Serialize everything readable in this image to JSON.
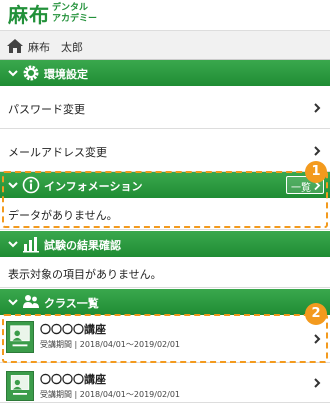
{
  "header": {
    "logo_main": "麻布",
    "logo_sub_1": "デンタル",
    "logo_sub_2": "アカデミー"
  },
  "user": {
    "name": "麻布　太郎"
  },
  "settings": {
    "title": "環境設定",
    "items": [
      {
        "label": "パスワード変更"
      },
      {
        "label": "メールアドレス変更"
      }
    ]
  },
  "information": {
    "title": "インフォメーション",
    "list_button": "一覧",
    "empty_text": "データがありません。",
    "badge": "1"
  },
  "exam": {
    "title": "試験の結果確認",
    "empty_text": "表示対象の項目がありません。"
  },
  "classes": {
    "title": "クラス一覧",
    "badge": "2",
    "items": [
      {
        "title": "〇〇〇〇講座",
        "period": "受講期間 | 2018/04/01〜2019/02/01"
      },
      {
        "title": "〇〇〇〇講座",
        "period": "受講期間 | 2018/04/01〜2019/02/01"
      }
    ]
  },
  "colors": {
    "accent": "#22913a",
    "highlight": "#f39a1e"
  }
}
